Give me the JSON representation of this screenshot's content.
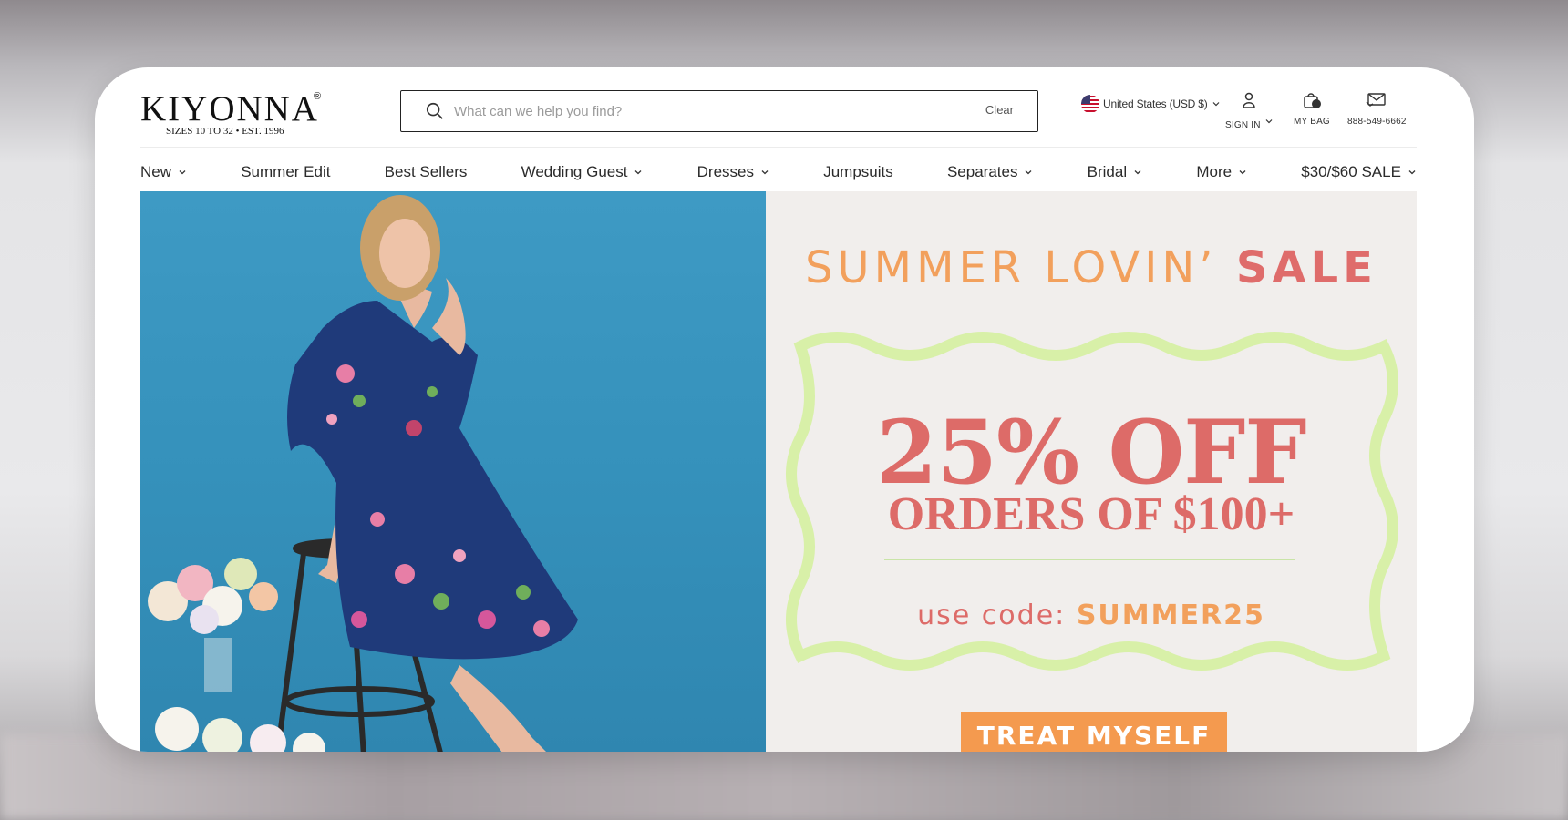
{
  "header": {
    "logo_text": "KIYONNA",
    "logo_reg": "®",
    "logo_tagline": "SIZES 10 TO 32  •  EST. 1996",
    "search": {
      "placeholder": "What can we help you find?",
      "clear_label": "Clear"
    },
    "region": {
      "label": "United States (USD $)",
      "flag_icon": "us-flag-icon"
    },
    "utilities": [
      {
        "label": "SIGN IN",
        "icon": "user-icon"
      },
      {
        "label": "MY BAG",
        "icon": "bag-icon",
        "count": "0"
      },
      {
        "label": "888-549-6662",
        "icon": "phone-mail-icon"
      }
    ]
  },
  "nav": {
    "items": [
      {
        "label": "New",
        "has_dropdown": true
      },
      {
        "label": "Summer Edit",
        "has_dropdown": false
      },
      {
        "label": "Best Sellers",
        "has_dropdown": false
      },
      {
        "label": "Wedding Guest",
        "has_dropdown": true
      },
      {
        "label": "Dresses",
        "has_dropdown": true
      },
      {
        "label": "Jumpsuits",
        "has_dropdown": false
      },
      {
        "label": "Separates",
        "has_dropdown": true
      },
      {
        "label": "Bridal",
        "has_dropdown": true
      },
      {
        "label": "More",
        "has_dropdown": true
      },
      {
        "label": "$30/$60 SALE",
        "has_dropdown": true
      }
    ]
  },
  "hero": {
    "image_description_icon": "model-photo",
    "headline_a": "SUMMER LOVIN’",
    "headline_b": "SALE",
    "offer": "25% OFF",
    "offer_sub": "ORDERS OF $100+",
    "code_label": "use code:",
    "code": "SUMMER25",
    "cta_label": "TREAT MYSELF"
  },
  "colors": {
    "accent_orange": "#f49a4f",
    "accent_coral": "#dd6b68",
    "frame_green": "#d8f0a8",
    "hero_blue": "#3591bb"
  }
}
